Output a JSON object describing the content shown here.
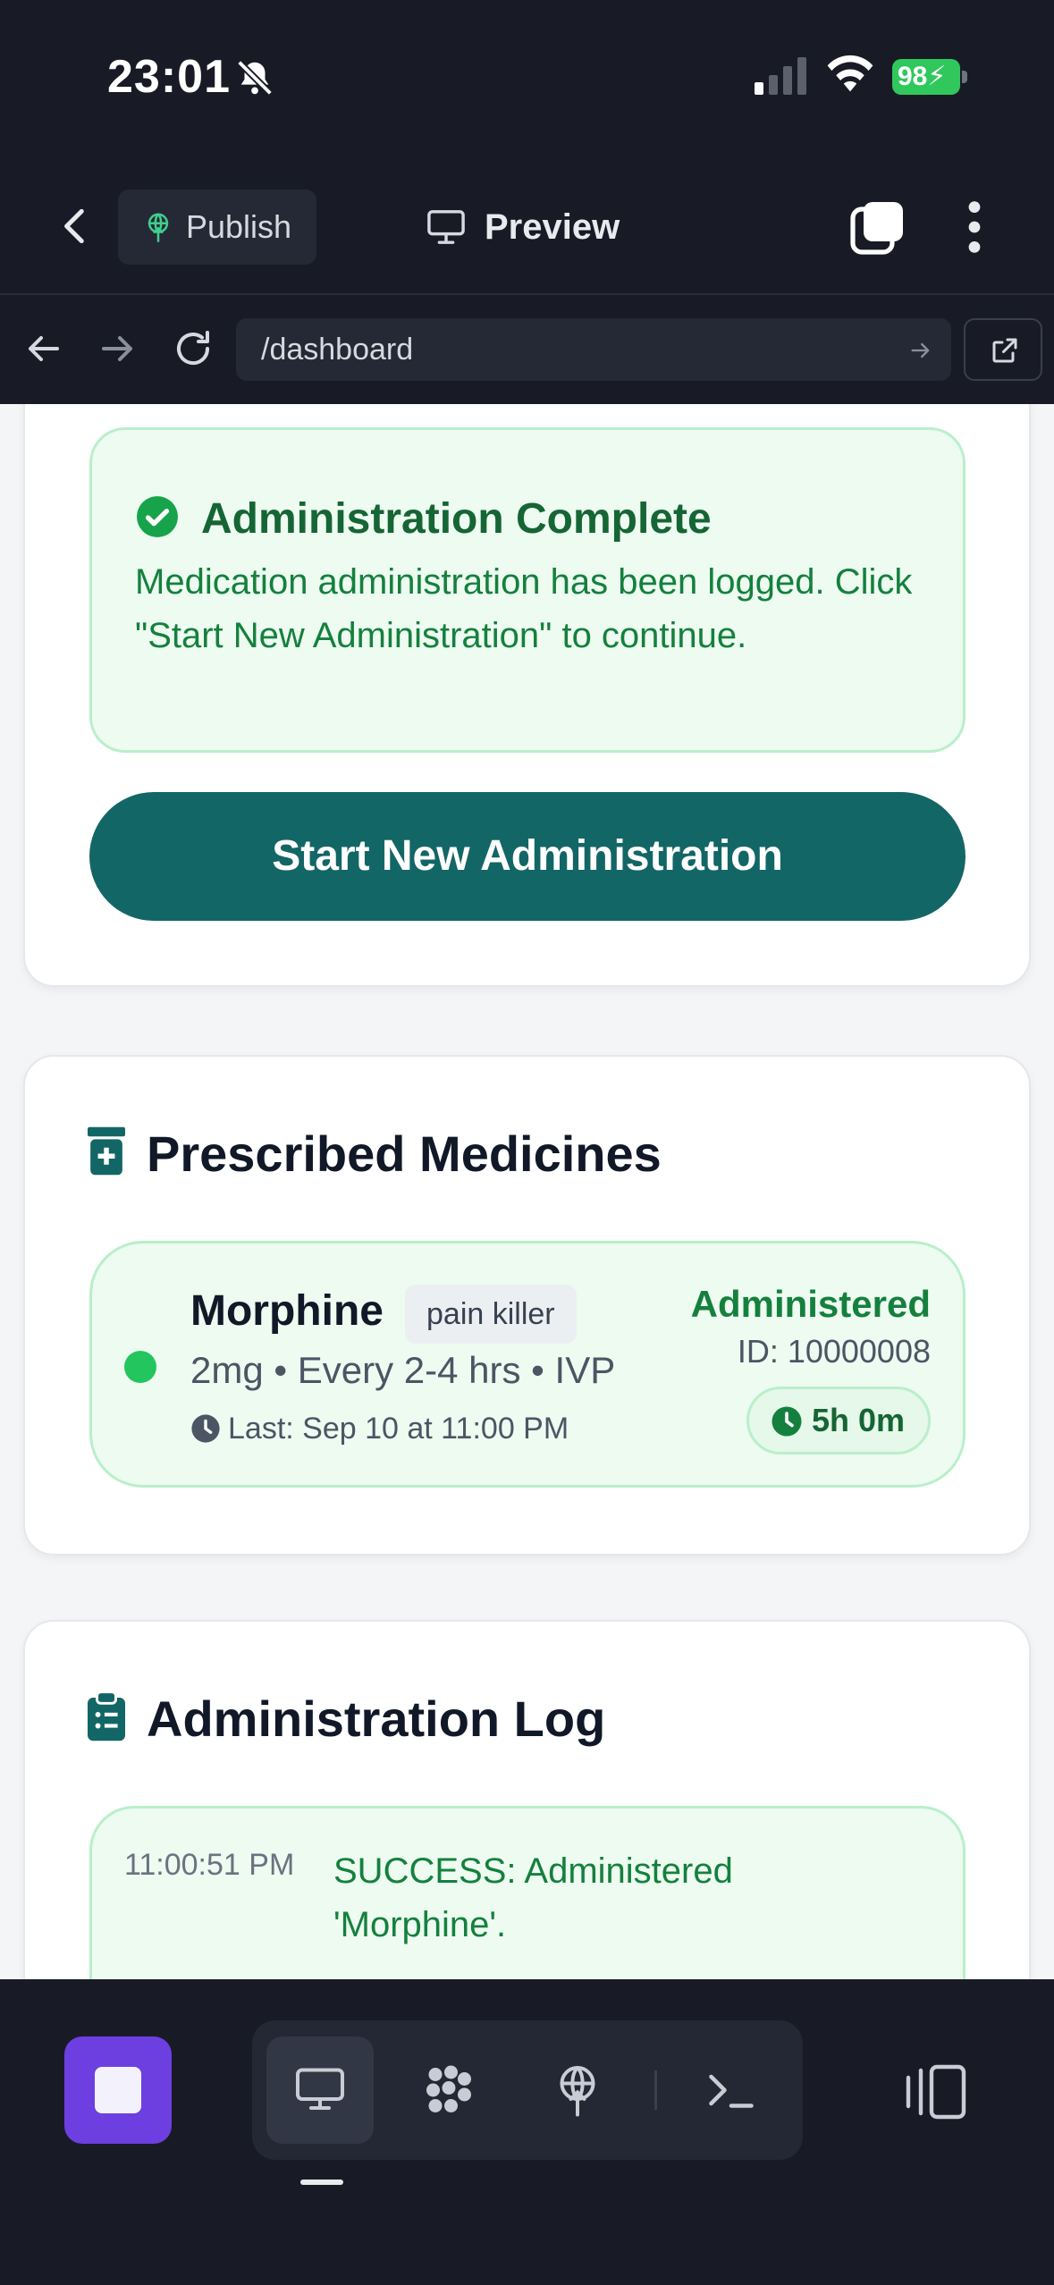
{
  "status_bar": {
    "time": "23:01",
    "battery": "98"
  },
  "app_bar": {
    "publish_label": "Publish",
    "preview_label": "Preview"
  },
  "browser": {
    "url": "/dashboard"
  },
  "success_panel": {
    "title": "Administration Complete",
    "message": "Medication administration has been logged. Click \"Start New Administration\" to continue.",
    "button_label": "Start New Administration"
  },
  "prescribed": {
    "title": "Prescribed Medicines",
    "medicines": [
      {
        "name": "Morphine",
        "tag": "pain killer",
        "dose_line": "2mg • Every 2-4 hrs • IVP",
        "last": "Last: Sep 10 at 11:00 PM",
        "status": "Administered",
        "id": "ID: 10000008",
        "timer": "5h 0m"
      }
    ]
  },
  "log": {
    "title": "Administration Log",
    "entries": [
      {
        "time": "11:00:51 PM",
        "message": "SUCCESS: Administered 'Morphine'."
      }
    ]
  },
  "colors": {
    "accent_teal": "#136666",
    "success_green": "#15803d",
    "stop_purple": "#6d3fe0"
  },
  "icons": [
    "bell-off-icon",
    "signal-icon",
    "wifi-icon",
    "battery-icon",
    "back-icon",
    "publish-icon",
    "monitor-icon",
    "tabs-icon",
    "more-icon",
    "arrow-left-icon",
    "arrow-right-icon",
    "reload-icon",
    "external-link-icon",
    "check-circle-icon",
    "pill-bottle-icon",
    "clock-icon",
    "clipboard-list-icon",
    "stop-icon",
    "grid-icon",
    "terminal-icon",
    "panel-icon"
  ]
}
